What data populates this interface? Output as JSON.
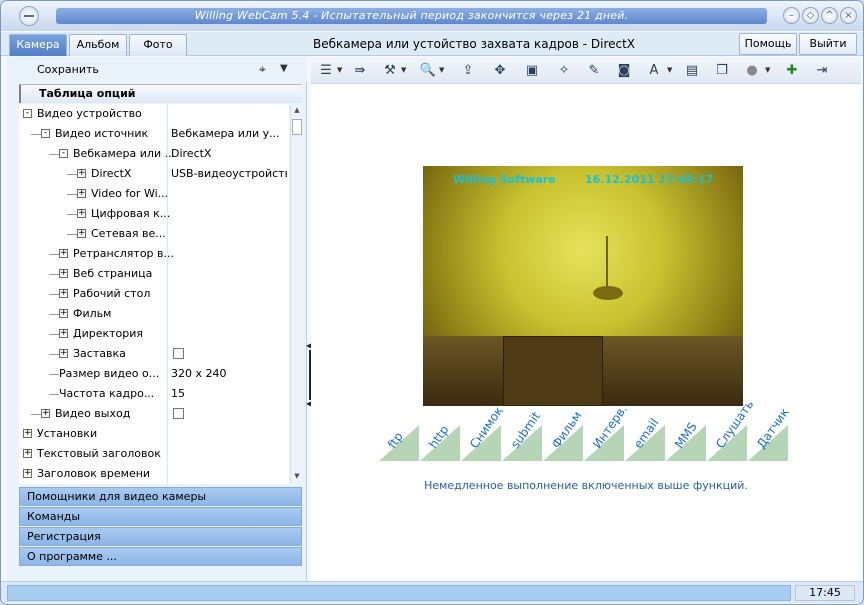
{
  "window": {
    "title": "Willing WebCam 5.4 - Испытательный период закончится через 21 дней."
  },
  "tabs": {
    "camera": "Камера",
    "album": "Альбом",
    "photo": "Фото",
    "center_title": "Вебкамера или устойство захвата кадров - DirectX",
    "help": "Помощь",
    "exit": "Выйти"
  },
  "left": {
    "save": "Сохранить",
    "options_header": "Таблица опций",
    "tree": [
      {
        "name": "Видео устройство",
        "value": "",
        "level": 0,
        "sign": "-"
      },
      {
        "name": "Видео источник",
        "value": "Вебкамера или у...",
        "level": 1,
        "sign": "-"
      },
      {
        "name": "Вебкамера или ...",
        "value": "DirectX",
        "level": 2,
        "sign": "-"
      },
      {
        "name": "DirectX",
        "value": "USB-видеоустройство",
        "level": 3,
        "sign": "+"
      },
      {
        "name": "Video for Wi...",
        "value": "",
        "level": 3,
        "sign": "+"
      },
      {
        "name": "Цифровая к...",
        "value": "",
        "level": 3,
        "sign": "+"
      },
      {
        "name": "Сетевая ве...",
        "value": "",
        "level": 3,
        "sign": "+"
      },
      {
        "name": "Ретранслятор в...",
        "value": "",
        "level": 2,
        "sign": "+"
      },
      {
        "name": "Веб страница",
        "value": "",
        "level": 2,
        "sign": "+"
      },
      {
        "name": "Рабочий стол",
        "value": "",
        "level": 2,
        "sign": "+"
      },
      {
        "name": "Фильм",
        "value": "",
        "level": 2,
        "sign": "+"
      },
      {
        "name": "Директория",
        "value": "",
        "level": 2,
        "sign": "+"
      },
      {
        "name": "Заставка",
        "value": "",
        "level": 2,
        "sign": "+",
        "checkbox": true
      },
      {
        "name": "Размер видео о...",
        "value": "320 x 240",
        "level": 2,
        "sign": ""
      },
      {
        "name": "Частота кадро...",
        "value": "15",
        "level": 2,
        "sign": ""
      },
      {
        "name": "Видео выход",
        "value": "",
        "level": 1,
        "sign": "+",
        "checkbox": true
      },
      {
        "name": "Установки",
        "value": "",
        "level": 0,
        "sign": "+"
      },
      {
        "name": "Текстовый заголовок",
        "value": "",
        "level": 0,
        "sign": "+"
      },
      {
        "name": "Заголовок времени",
        "value": "",
        "level": 0,
        "sign": "+"
      }
    ],
    "groups": [
      "Помощники для видео камеры",
      "Команды",
      "Регистрация",
      "О программе ..."
    ]
  },
  "video": {
    "overlay_left": "Willing Software",
    "overlay_right": "16.12.2011 17:45:17"
  },
  "functions": [
    "ftp",
    "http",
    "Снимок",
    "submit",
    "Фильм",
    "Интерв.",
    "email",
    "MMS",
    "Слушать",
    "Датчик"
  ],
  "info_text": "Немедленное выполнение включенных выше функций.",
  "status": {
    "time": "17:45"
  }
}
